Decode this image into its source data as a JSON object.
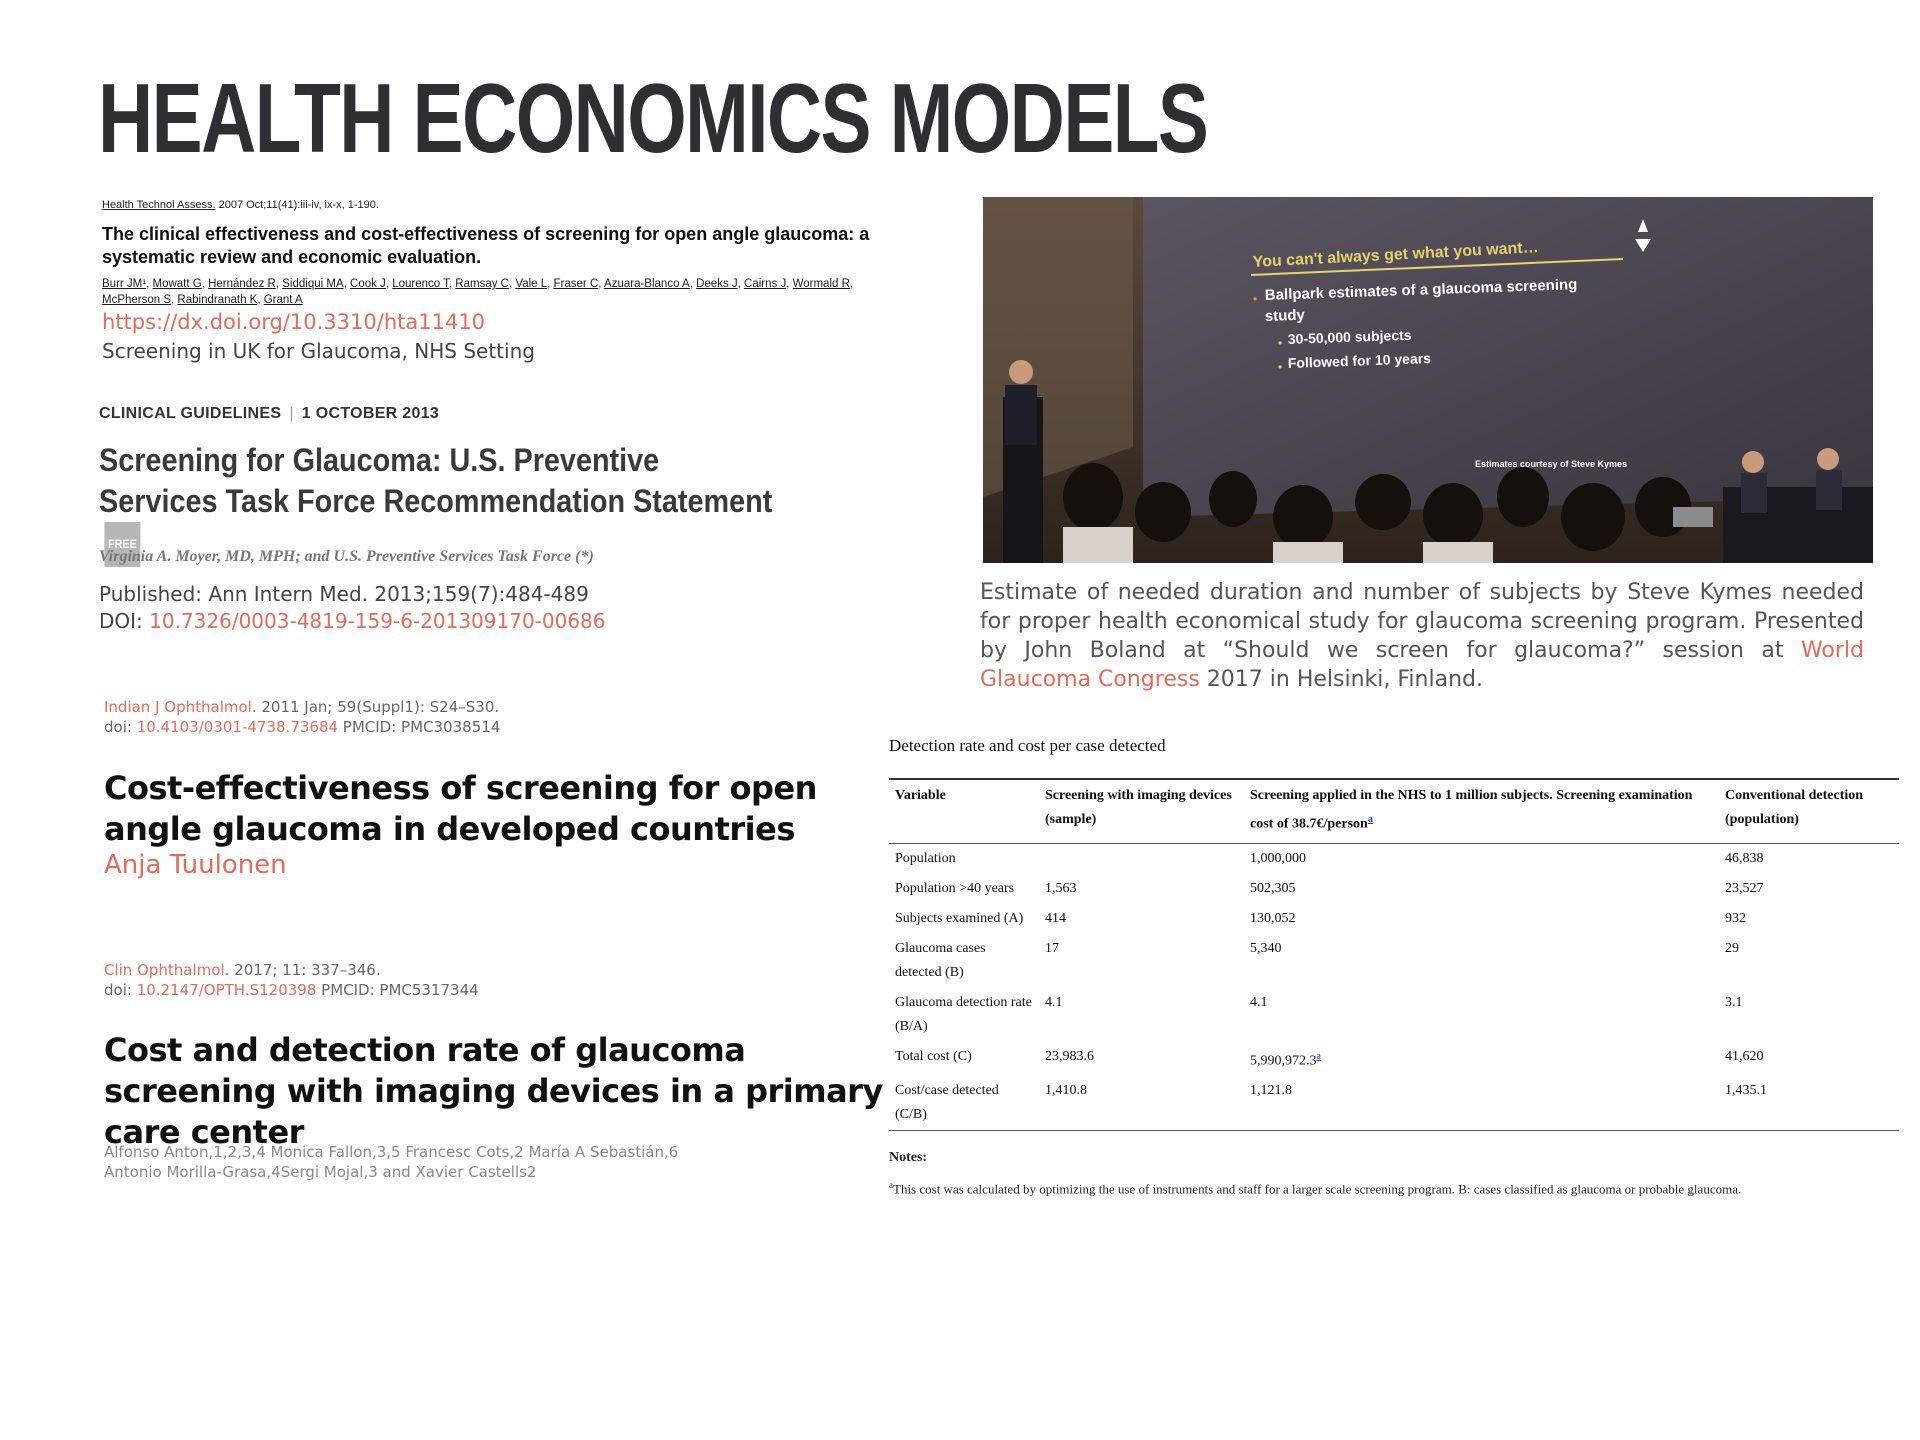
{
  "slide": {
    "title": "HEALTH ECONOMICS MODELS"
  },
  "ref1": {
    "journal": "Health Technol Assess.",
    "journal_rest": " 2007 Oct;11(41):iii-iv, ix-x, 1-190.",
    "title": "The clinical effectiveness and cost-effectiveness of screening for open angle glaucoma: a systematic review and economic evaluation.",
    "authors": [
      "Burr JM¹",
      "Mowatt G",
      "Hernández R",
      "Siddiqui MA",
      "Cook J",
      "Lourenco T",
      "Ramsay C",
      "Vale L",
      "Fraser C",
      "Azuara-Blanco A",
      "Deeks J",
      "Cairns J",
      "Wormald R",
      "McPherson S",
      "Rabindranath K",
      "Grant A"
    ],
    "doi_link": "https://dx.doi.org/10.3310/hta11410",
    "note": "Screening in UK for Glaucoma, NHS Setting"
  },
  "ref2": {
    "category": "CLINICAL GUIDELINES",
    "date": "1 OCTOBER 2013",
    "title": "Screening for Glaucoma: U.S. Preventive Services Task Force Recommendation Statement",
    "badge": "FREE",
    "authors": "Virginia A. Moyer, MD, MPH; and U.S. Preventive Services Task Force (*)",
    "published": "Published: Ann Intern Med. 2013;159(7):484-489",
    "doi_label": "DOI: ",
    "doi_link": "10.7326/0003-4819-159-6-201309170-00686"
  },
  "ref3": {
    "journal": "Indian J Ophthalmol",
    "journal_rest": ". 2011 Jan; 59(Suppl1): S24–S30.",
    "doi_label": "doi: ",
    "doi_link": "10.4103/0301-4738.73684",
    "pmcid": " PMCID: PMC3038514",
    "title": "Cost-effectiveness of screening for open angle glaucoma in developed countries",
    "author": "Anja Tuulonen"
  },
  "ref4": {
    "journal": "Clin Ophthalmol",
    "journal_rest": ". 2017; 11: 337–346.",
    "doi_label": "doi: ",
    "doi_link": "10.2147/OPTH.S120398",
    "pmcid": " PMCID: PMC5317344",
    "title": "Cost and detection rate of glaucoma screening with imaging devices in a primary care center",
    "authors_line1": "Alfonso Anton,1,2,3,4 Monica Fallon,3,5 Francesc Cots,2 María A Sebastián,6",
    "authors_line2": "Antonio Morilla-Grasa,4Sergi Mojal,3 and Xavier Castells2"
  },
  "photo": {
    "slide_heading": "You can't always get what you want…",
    "bullet_main_1": "Ballpark estimates of a glaucoma screening",
    "bullet_main_2": "study",
    "sub1": "30-50,000 subjects",
    "sub2": "Followed for 10 years",
    "credit": "Estimates courtesy of Steve Kymes"
  },
  "caption": {
    "text_before": "Estimate of needed duration and number of subjects by Steve Kymes needed for proper health economical study for glaucoma screening program. Presented by John Boland at “Should we screen for glaucoma?” session at ",
    "link": "World Glaucoma Congress",
    "text_after": " 2017 in Helsinki, Finland."
  },
  "table": {
    "title": "Detection rate and cost per case detected",
    "headers": [
      "Variable",
      "Screening with imaging devices (sample)",
      "Screening applied in the NHS to 1 million subjects. Screening examination cost of 38.7€/person",
      "Conventional detection (population)"
    ],
    "header_sup": "a",
    "rows": [
      [
        "Population",
        "",
        "1,000,000",
        "46,838"
      ],
      [
        "Population >40 years",
        "1,563",
        "502,305",
        "23,527"
      ],
      [
        "Subjects examined (A)",
        "414",
        "130,052",
        "932"
      ],
      [
        "Glaucoma cases detected (B)",
        "17",
        "5,340",
        "29"
      ],
      [
        "Glaucoma detection rate (B/A)",
        "4.1",
        "4.1",
        "3.1"
      ],
      [
        "Total cost (C)",
        "23,983.6",
        "5,990,972.3",
        "41,620"
      ],
      [
        "Cost/case detected (C/B)",
        "1,410.8",
        "1,121.8",
        "1,435.1"
      ]
    ],
    "total_cost_sup": "a",
    "notes_label": "Notes:",
    "notes_sup": "a",
    "notes_text": "This cost was calculated by optimizing the use of instruments and staff for a larger scale screening program. B: cases classified as glaucoma or probable glaucoma."
  },
  "colors": {
    "accent": "#e46b5c",
    "title": "#2f2f33",
    "link_blue": "#1a3fa6"
  }
}
